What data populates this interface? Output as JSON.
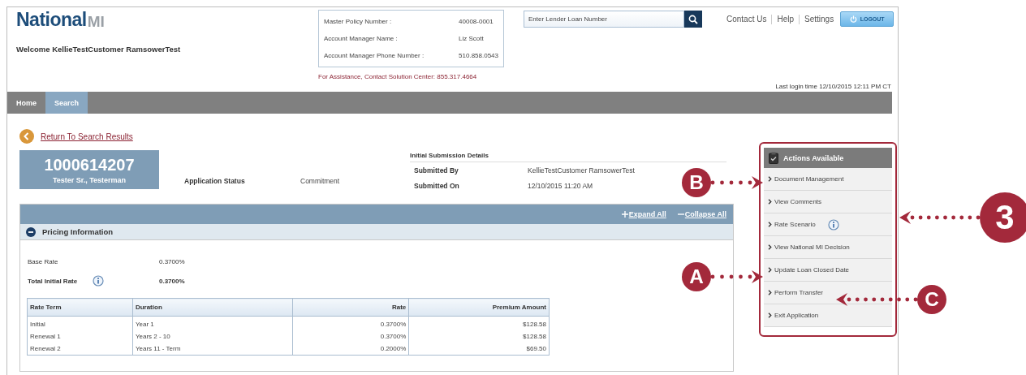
{
  "header": {
    "logo": {
      "main": "National",
      "suffix": "MI"
    },
    "welcome": "Welcome KellieTestCustomer RamsowerTest",
    "policy_info": [
      {
        "label": "Master Policy Number :",
        "value": "40008-0001"
      },
      {
        "label": "Account Manager Name :",
        "value": "Liz Scott"
      },
      {
        "label": "Account Manager Phone Number :",
        "value": "510.858.0543"
      }
    ],
    "assistance": "For Assistance, Contact Solution Center: 855.317.4664",
    "search": {
      "placeholder": "Enter Lender Loan Number"
    },
    "links": [
      "Contact Us",
      "Help",
      "Settings"
    ],
    "logout": "LOGOUT",
    "last_login": "Last login time 12/10/2015 12:11 PM CT"
  },
  "nav": [
    {
      "label": "Home",
      "selected": false
    },
    {
      "label": "Search",
      "selected": true
    }
  ],
  "back_link": "Return To Search Results",
  "loan": {
    "number": "1000614207",
    "borrower": "Tester Sr., Testerman",
    "status_label": "Application Status",
    "status": "Commitment"
  },
  "submission": {
    "title": "Initial Submission Details",
    "fields": [
      {
        "label": "Submitted By",
        "value": "KellieTestCustomer RamsowerTest"
      },
      {
        "label": "Submitted On",
        "value": "12/10/2015 11:20 AM"
      }
    ]
  },
  "panel": {
    "expand": "Expand All",
    "collapse": "Collapse All",
    "section": {
      "title": "Pricing Information",
      "expanded": true
    },
    "rates": [
      {
        "label": "Base Rate",
        "value": "0.3700%",
        "emphasized": false,
        "info": false
      },
      {
        "label": "Total Initial Rate",
        "value": "0.3700%",
        "emphasized": true,
        "info": true
      }
    ],
    "table": {
      "columns": [
        "Rate Term",
        "Duration",
        "Rate",
        "Premium Amount"
      ],
      "rows": [
        [
          "Initial",
          "Year 1",
          "0.3700%",
          "$128.58"
        ],
        [
          "Renewal 1",
          "Years 2 - 10",
          "0.3700%",
          "$128.58"
        ],
        [
          "Renewal 2",
          "Years 11 - Term",
          "0.2000%",
          "$69.50"
        ]
      ]
    }
  },
  "actions": {
    "title": "Actions Available",
    "items": [
      {
        "label": "Document Management",
        "info": false
      },
      {
        "label": "View Comments",
        "info": false
      },
      {
        "label": "Rate Scenario",
        "info": true
      },
      {
        "label": "View National MI Decision",
        "info": false
      },
      {
        "label": "Update Loan Closed Date",
        "info": false
      },
      {
        "label": "Perform Transfer",
        "info": false
      },
      {
        "label": "Exit Application",
        "info": false
      }
    ]
  },
  "callouts": [
    {
      "label": "B"
    },
    {
      "label": "A"
    },
    {
      "label": "C"
    },
    {
      "label": "3"
    }
  ]
}
